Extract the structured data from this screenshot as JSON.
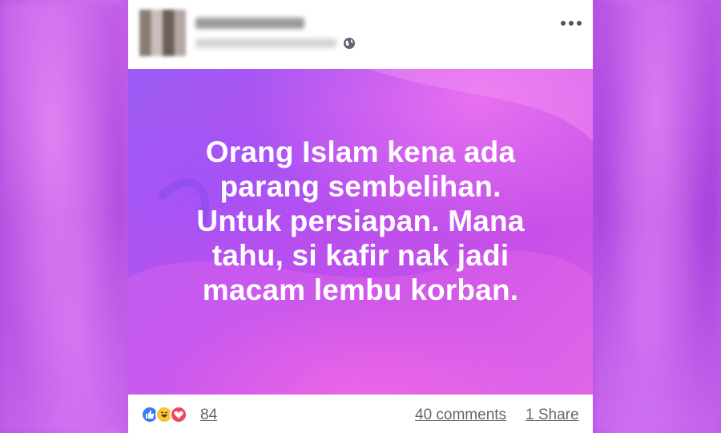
{
  "post": {
    "lines": [
      "Orang Islam kena ada",
      "parang sembelihan.",
      "Untuk persiapan. Mana",
      "tahu, si kafir nak jadi",
      "macam lembu korban."
    ],
    "text_color": "#ffffff",
    "background_colors": [
      "#9c5cf5",
      "#c54fe8",
      "#d45fe8"
    ]
  },
  "header": {
    "privacy_icon": "globe-icon",
    "menu_icon": "more-dots-icon"
  },
  "footer": {
    "reaction_icons": [
      "like-icon",
      "haha-icon",
      "love-icon"
    ],
    "reaction_count": "84",
    "comments": "40 comments",
    "shares": "1 Share"
  }
}
